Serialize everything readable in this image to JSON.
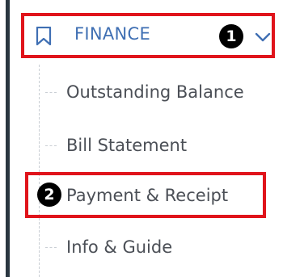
{
  "menu": {
    "header_label": "FINANCE",
    "header_icon": "bookmark-icon",
    "expand_icon": "chevron-down-icon",
    "items": [
      {
        "label": "Outstanding Balance"
      },
      {
        "label": "Bill Statement"
      },
      {
        "label": "Payment & Receipt"
      },
      {
        "label": "Info & Guide"
      }
    ]
  },
  "annotations": {
    "badges": [
      "1",
      "2"
    ],
    "highlight_color": "#e0141b"
  },
  "colors": {
    "accent": "#3f6fb3",
    "text": "#4b4f56",
    "rail": "#2a3640"
  }
}
